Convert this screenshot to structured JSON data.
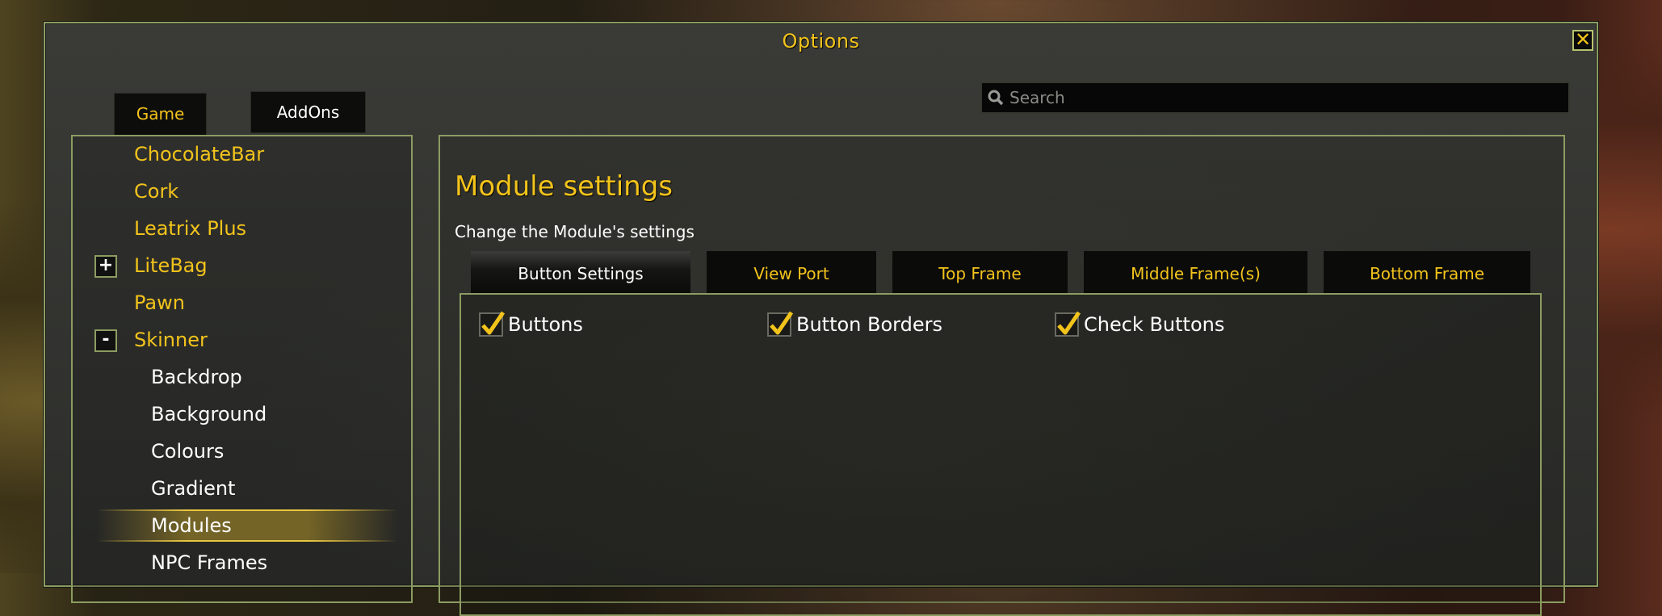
{
  "window": {
    "title": "Options",
    "close_icon": "close-icon"
  },
  "search": {
    "placeholder": "Search",
    "value": ""
  },
  "top_tabs": [
    {
      "label": "Game",
      "active": true
    },
    {
      "label": "AddOns",
      "active": false
    }
  ],
  "tree": [
    {
      "label": "ChocolateBar",
      "level": 0
    },
    {
      "label": "Cork",
      "level": 0
    },
    {
      "label": "Leatrix Plus",
      "level": 0
    },
    {
      "label": "LiteBag",
      "level": 0,
      "toggle": "+"
    },
    {
      "label": "Pawn",
      "level": 0
    },
    {
      "label": "Skinner",
      "level": 0,
      "toggle": "-"
    },
    {
      "label": "Backdrop",
      "level": 1
    },
    {
      "label": "Background",
      "level": 1
    },
    {
      "label": "Colours",
      "level": 1
    },
    {
      "label": "Gradient",
      "level": 1
    },
    {
      "label": "Modules",
      "level": 1,
      "selected": true
    },
    {
      "label": "NPC Frames",
      "level": 1
    }
  ],
  "main": {
    "heading": "Module settings",
    "subheading": "Change the Module's settings",
    "tabs": [
      {
        "label": "Button Settings",
        "active": true
      },
      {
        "label": "View Port",
        "active": false
      },
      {
        "label": "Top Frame",
        "active": false
      },
      {
        "label": "Middle Frame(s)",
        "active": false
      },
      {
        "label": "Bottom Frame",
        "active": false
      }
    ],
    "checkboxes": [
      {
        "label": "Buttons",
        "checked": true
      },
      {
        "label": "Button Borders",
        "checked": true
      },
      {
        "label": "Check Buttons",
        "checked": true
      }
    ]
  },
  "colors": {
    "accent_gold": "#f2c31b",
    "border_green": "#8c9c62"
  }
}
